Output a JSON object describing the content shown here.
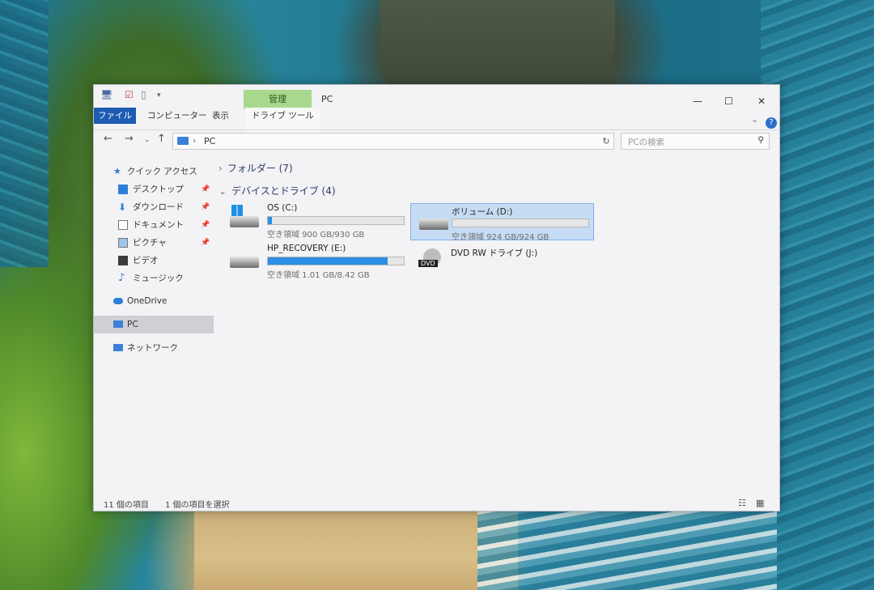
{
  "window": {
    "title": "PC",
    "manage_tab": "管理",
    "tabs": [
      "ファイル",
      "コンピューター",
      "表示",
      "ドライブ ツール"
    ],
    "controls": {
      "minimize": "—",
      "maximize": "☐",
      "close": "✕"
    },
    "ribbon_expand": "⌄",
    "help": "?"
  },
  "address": {
    "path": "PC",
    "separator": "›",
    "search_placeholder": "PCの検索"
  },
  "nav": {
    "quick_access": "クイック アクセス",
    "items": [
      {
        "label": "デスクトップ",
        "pinned": true
      },
      {
        "label": "ダウンロード",
        "pinned": true
      },
      {
        "label": "ドキュメント",
        "pinned": true
      },
      {
        "label": "ピクチャ",
        "pinned": true
      },
      {
        "label": "ビデオ",
        "pinned": false
      },
      {
        "label": "ミュージック",
        "pinned": false
      }
    ],
    "onedrive": "OneDrive",
    "pc": "PC",
    "network": "ネットワーク"
  },
  "groups": {
    "folders": "フォルダー (7)",
    "devices": "デバイスとドライブ (4)"
  },
  "drives": [
    {
      "name": "OS (C:)",
      "space": "空き領域 900 GB/930 GB",
      "used_fraction": 0.03
    },
    {
      "name": "ボリューム (D:)",
      "space": "空き領域 924 GB/924 GB",
      "used_fraction": 0.0
    },
    {
      "name": "HP_RECOVERY (E:)",
      "space": "空き領域 1.01 GB/8.42 GB",
      "used_fraction": 0.88
    },
    {
      "name": "DVD RW ドライブ (J:)",
      "space": "",
      "used_fraction": null
    }
  ],
  "dvd_label": "DVD",
  "status": {
    "items": "11 個の項目",
    "selected": "1 個の項目を選択"
  },
  "colors": {
    "file_tab": "#1c5cb3",
    "manage_tab": "#a8d88e",
    "progress": "#2c8fe3",
    "selection": "#c6dcf4"
  }
}
